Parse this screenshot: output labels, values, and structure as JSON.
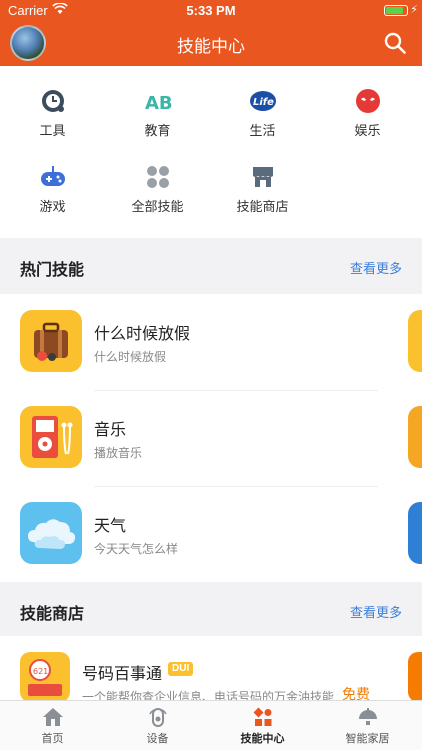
{
  "status": {
    "carrier": "Carrier",
    "time": "5:33 PM",
    "battery_level": 0.9
  },
  "header": {
    "title": "技能中心"
  },
  "categories": [
    {
      "label": "工具",
      "icon": "clock-icon"
    },
    {
      "label": "教育",
      "icon": "abc-icon"
    },
    {
      "label": "生活",
      "icon": "life-icon"
    },
    {
      "label": "娱乐",
      "icon": "mask-icon"
    },
    {
      "label": "游戏",
      "icon": "gamepad-icon"
    },
    {
      "label": "全部技能",
      "icon": "grid-dots-icon"
    },
    {
      "label": "技能商店",
      "icon": "store-icon"
    }
  ],
  "hot_skills": {
    "title": "热门技能",
    "more": "查看更多",
    "items": [
      {
        "name": "什么时候放假",
        "desc": "什么时候放假",
        "icon": "suitcase-icon"
      },
      {
        "name": "音乐",
        "desc": "播放音乐",
        "icon": "music-player-icon"
      },
      {
        "name": "天气",
        "desc": "今天天气怎么样",
        "icon": "cloud-icon"
      }
    ]
  },
  "skill_store": {
    "title": "技能商店",
    "more": "查看更多",
    "items": [
      {
        "name": "号码百事通",
        "badge": "DUI",
        "desc": "一个能帮你查企业信息、电话号码的万金油技能",
        "price": "免费"
      }
    ]
  },
  "tabs": [
    {
      "label": "首页",
      "icon": "home-icon",
      "active": false
    },
    {
      "label": "设备",
      "icon": "device-icon",
      "active": false
    },
    {
      "label": "技能中心",
      "icon": "skills-icon",
      "active": true
    },
    {
      "label": "智能家居",
      "icon": "smart-home-icon",
      "active": false
    }
  ],
  "colors": {
    "brand": "#e9561f",
    "link": "#3c7fd8",
    "price": "#f57c00"
  }
}
